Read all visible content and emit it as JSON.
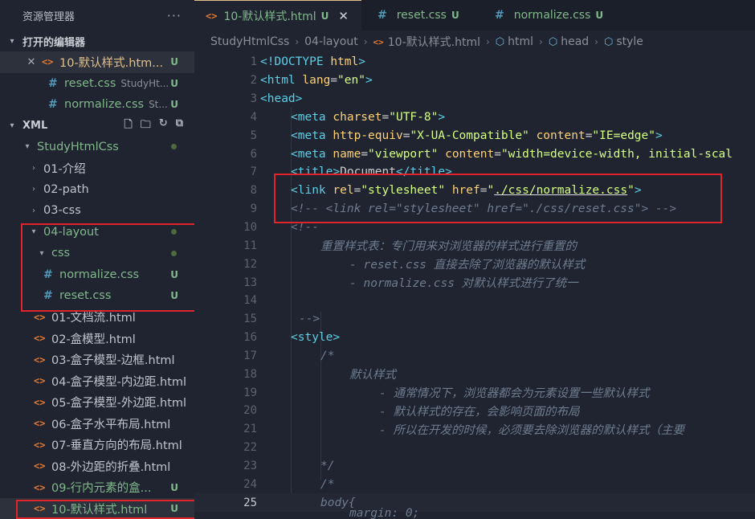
{
  "explorer": {
    "title": "资源管理器",
    "more": "···",
    "open_editors_label": "打开的编辑器",
    "open_editors": [
      {
        "name": "10-默认样式.htm...",
        "badge": "U",
        "sub": ""
      },
      {
        "name": "reset.css",
        "badge": "U",
        "sub": "StudyHt..."
      },
      {
        "name": "normalize.css",
        "badge": "U",
        "sub": "St..."
      }
    ],
    "workspace_label": "XML",
    "root_folder": "StudyHtmlCss",
    "folders": [
      "01-介绍",
      "02-path",
      "03-css"
    ],
    "layout_folder": "04-layout",
    "css_folder": "css",
    "css_files": [
      {
        "name": "normalize.css",
        "badge": "U"
      },
      {
        "name": "reset.css",
        "badge": "U"
      }
    ],
    "html_files": [
      {
        "name": "01-文档流.html",
        "badge": ""
      },
      {
        "name": "02-盒模型.html",
        "badge": ""
      },
      {
        "name": "03-盒子模型-边框.html",
        "badge": ""
      },
      {
        "name": "04-盒子模型-内边距.html",
        "badge": ""
      },
      {
        "name": "05-盒子模型-外边距.html",
        "badge": ""
      },
      {
        "name": "06-盒子水平布局.html",
        "badge": ""
      },
      {
        "name": "07-垂直方向的布局.html",
        "badge": ""
      },
      {
        "name": "08-外边距的折叠.html",
        "badge": ""
      },
      {
        "name": "09-行内元素的盒...",
        "badge": "U"
      },
      {
        "name": "10-默认样式.html",
        "badge": "U"
      }
    ]
  },
  "tabs": [
    {
      "name": "10-默认样式.html",
      "badge": "U",
      "close": "✕"
    },
    {
      "name": "reset.css",
      "badge": "U"
    },
    {
      "name": "normalize.css",
      "badge": "U"
    }
  ],
  "breadcrumb": [
    "StudyHtmlCss",
    "04-layout",
    "10-默认样式.html",
    "html",
    "head",
    "style"
  ],
  "code_lines": {
    "l1": "1",
    "l2": "2",
    "l3": "3",
    "l4": "4",
    "l5": "5",
    "l6": "6",
    "l7": "7",
    "l8": "8",
    "l9": "9",
    "l10": "10",
    "l11": "11",
    "l12": "12",
    "l13": "13",
    "l14": "14",
    "l15": "15",
    "l16": "16",
    "l17": "17",
    "l18": "18",
    "l19": "19",
    "l20": "20",
    "l21": "21",
    "l22": "22",
    "l23": "23",
    "l24": "24",
    "l25": "25",
    "comment_title": "重置样式表：专门用来对浏览器的样式进行重置的",
    "comment_reset": "- reset.css 直接去除了浏览器的默认样式",
    "comment_normalize": "- normalize.css 对默认样式进行了统一",
    "c_default": "默认样式",
    "c_b1": "- 通常情况下，浏览器都会为元素设置一些默认样式",
    "c_b2": "- 默认样式的存在，会影响页面的布局",
    "c_b3": "- 所以在开发的时候，必须要去除浏览器的默认样式（主要"
  },
  "colors": {
    "accent": "#e2c08d",
    "untracked": "#81b88b",
    "highlight_box": "#e0242a"
  }
}
